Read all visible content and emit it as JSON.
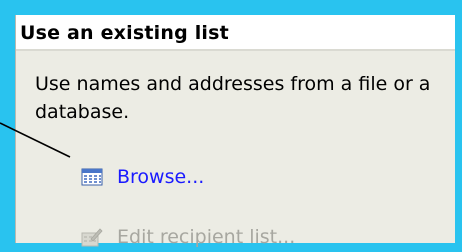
{
  "section": {
    "title": "Use an existing list",
    "description": "Use names and addresses from a file or a database."
  },
  "actions": {
    "browse": {
      "label": "Browse...",
      "icon": "address-book-icon"
    },
    "edit": {
      "label": "Edit recipient list...",
      "icon": "edit-list-icon",
      "enabled": false
    }
  },
  "colors": {
    "background": "#29c3ef",
    "panel": "#ecece4",
    "link": "#1a1aff",
    "disabled": "#a7a7a0"
  }
}
